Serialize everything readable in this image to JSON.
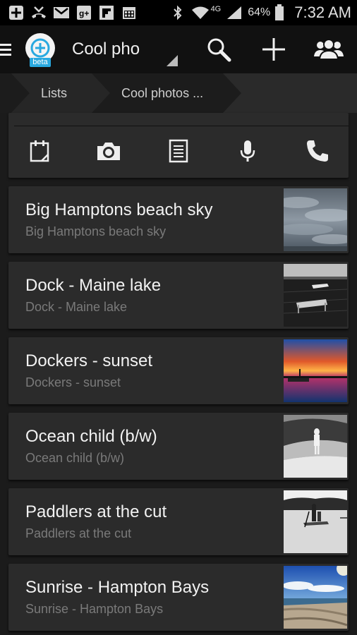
{
  "status_bar": {
    "network": "4G",
    "battery": "64%",
    "time": "7:32 AM"
  },
  "app_bar": {
    "logo_badge": "beta",
    "title": "Cool pho"
  },
  "breadcrumb": [
    "Lists",
    "Cool photos ..."
  ],
  "quick_add": [
    "calendar-icon",
    "camera-icon",
    "document-icon",
    "microphone-icon",
    "phone-icon"
  ],
  "items": [
    {
      "title": "Big Hamptons beach sky",
      "subtitle": "Big Hamptons beach sky",
      "thumb": "cloudy-sky"
    },
    {
      "title": "Dock - Maine lake",
      "subtitle": "Dock - Maine lake",
      "thumb": "dock-lake"
    },
    {
      "title": "Dockers - sunset",
      "subtitle": "Dockers - sunset",
      "thumb": "sunset"
    },
    {
      "title": "Ocean child (b/w)",
      "subtitle": "Ocean child (b/w)",
      "thumb": "ocean-child"
    },
    {
      "title": "Paddlers at the cut",
      "subtitle": "Paddlers at the cut",
      "thumb": "paddlers"
    },
    {
      "title": "Sunrise - Hampton Bays",
      "subtitle": "Sunrise - Hampton Bays",
      "thumb": "sunrise-beach"
    }
  ],
  "colors": {
    "status_bar": "#000000",
    "action_bar": "#111111",
    "card": "#2b2b2b",
    "background": "#1b1b1b",
    "logo_accent": "#29a9e0"
  }
}
